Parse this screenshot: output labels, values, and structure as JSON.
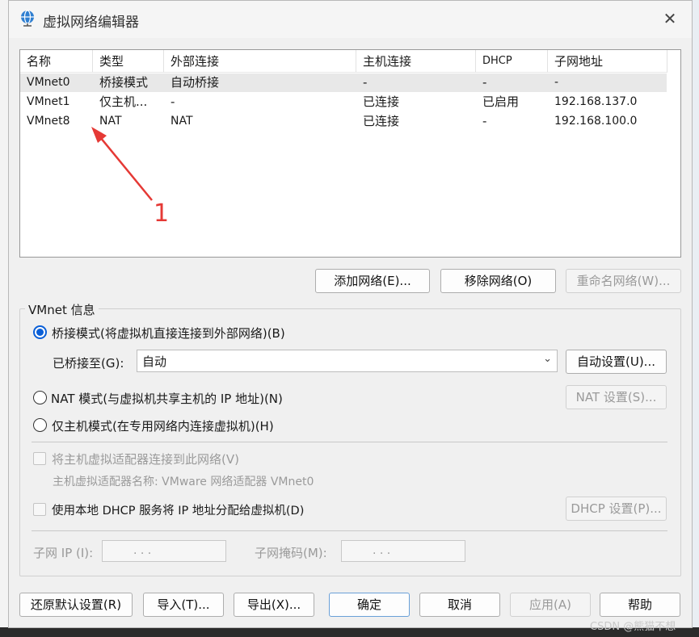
{
  "window": {
    "title": "虚拟网络编辑器",
    "close_glyph": "✕"
  },
  "table": {
    "headers": [
      "名称",
      "类型",
      "外部连接",
      "主机连接",
      "DHCP",
      "子网地址"
    ],
    "rows": [
      [
        "VMnet0",
        "桥接模式",
        "自动桥接",
        "-",
        "-",
        "-"
      ],
      [
        "VMnet1",
        "仅主机...",
        "-",
        "已连接",
        "已启用",
        "192.168.137.0"
      ],
      [
        "VMnet8",
        "NAT",
        "NAT",
        "已连接",
        "-",
        "192.168.100.0"
      ]
    ],
    "selected_row": 0
  },
  "annotation": {
    "label": "1",
    "color": "#e53935"
  },
  "network_buttons": {
    "add": "添加网络(E)...",
    "remove": "移除网络(O)",
    "rename": "重命名网络(W)..."
  },
  "vmnet_info": {
    "group_label": "VMnet 信息",
    "bridged_label": "桥接模式(将虚拟机直接连接到外部网络)(B)",
    "bridged_to_label": "已桥接至(G):",
    "bridged_to_value": "自动",
    "auto_settings": "自动设置(U)...",
    "nat_label": "NAT 模式(与虚拟机共享主机的 IP 地址)(N)",
    "nat_settings": "NAT 设置(S)...",
    "hostonly_label": "仅主机模式(在专用网络内连接虚拟机)(H)",
    "connect_adapter_label": "将主机虚拟适配器连接到此网络(V)",
    "adapter_name_label": "主机虚拟适配器名称: VMware 网络适配器 VMnet0",
    "dhcp_label": "使用本地 DHCP 服务将 IP 地址分配给虚拟机(D)",
    "dhcp_settings": "DHCP 设置(P)...",
    "subnet_ip_label": "子网 IP (I):",
    "subnet_mask_label": "子网掩码(M):",
    "ip_dots": ".   .   ."
  },
  "footer_buttons": {
    "restore": "还原默认设置(R)",
    "import": "导入(T)...",
    "export": "导出(X)...",
    "ok": "确定",
    "cancel": "取消",
    "apply": "应用(A)",
    "help": "帮助"
  },
  "watermark": "CSDN @熊猫不想"
}
